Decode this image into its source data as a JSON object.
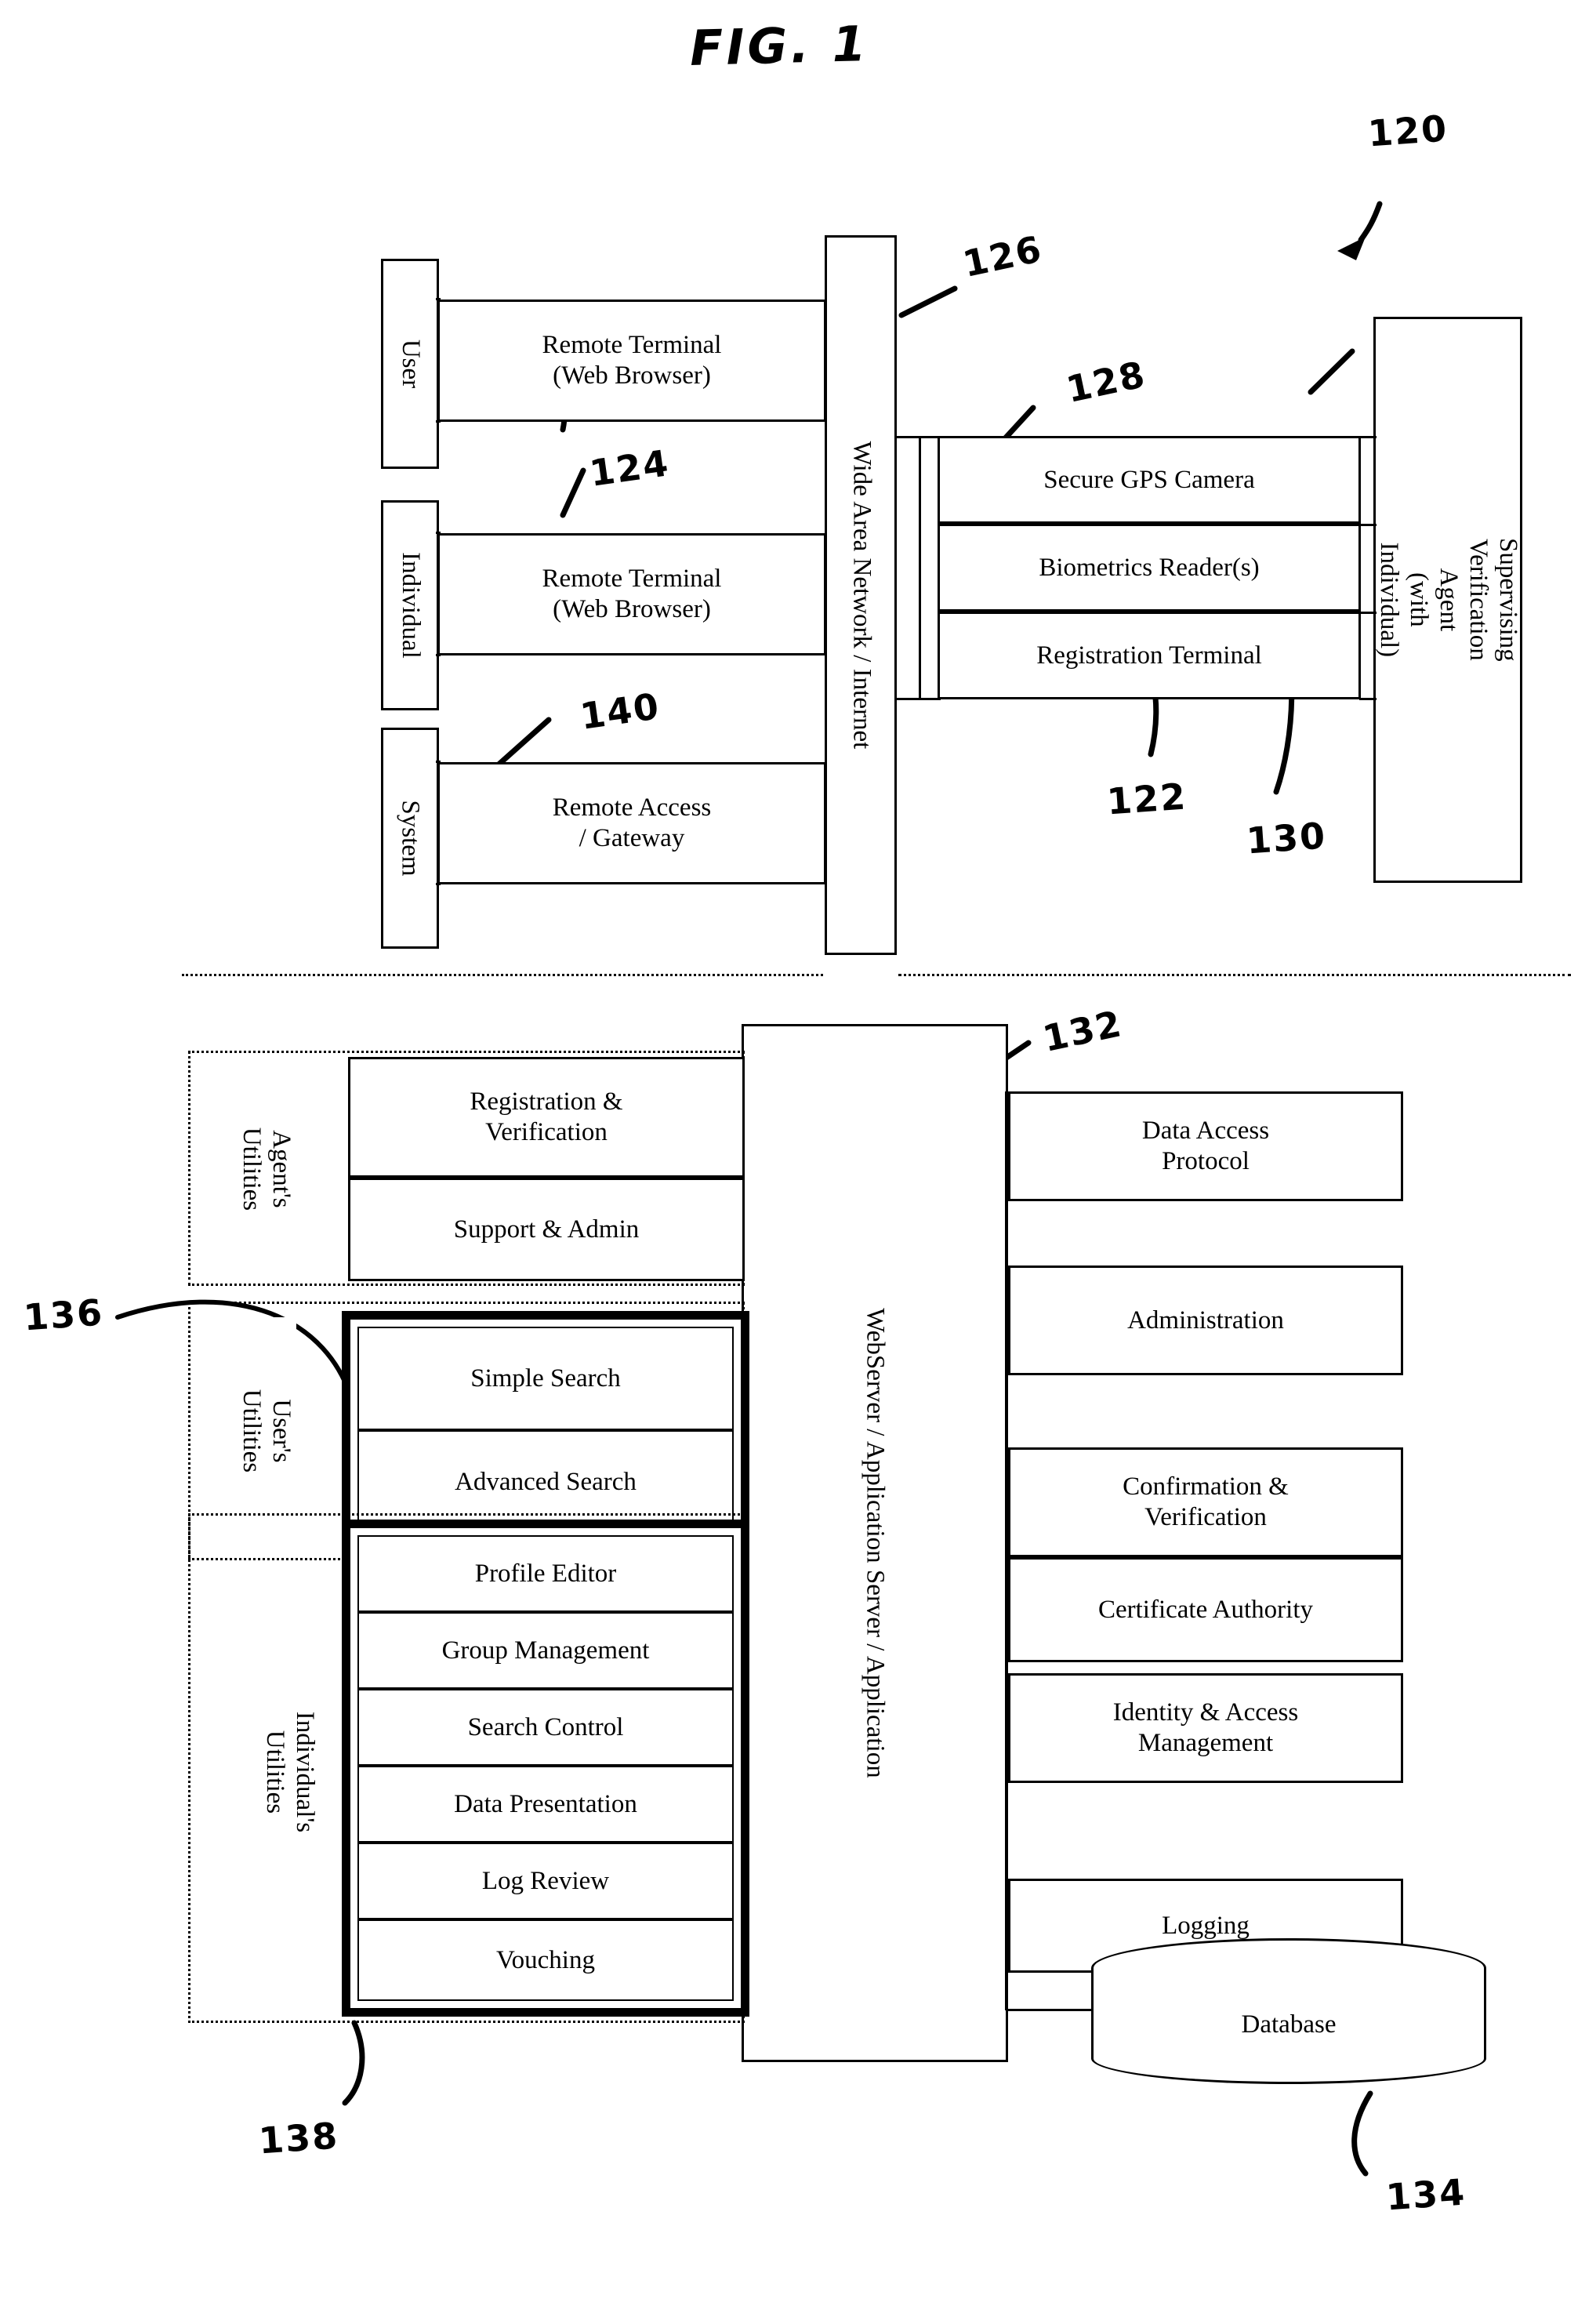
{
  "figure": {
    "title": "FIG. 1",
    "system_ref": "120"
  },
  "network": {
    "label": "Wide Area Network / Internet",
    "ref": "126"
  },
  "server": {
    "label": "WebServer / Application Server / Application",
    "ref": "132"
  },
  "actors": [
    {
      "label": "User"
    },
    {
      "label": "Individual"
    },
    {
      "label": "System"
    }
  ],
  "client_nodes": [
    {
      "label": "Remote Terminal\n(Web Browser)",
      "line1": "Remote Terminal",
      "line2": "(Web Browser)",
      "ref": ""
    },
    {
      "label": "Remote Terminal\n(Web Browser)",
      "line1": "Remote Terminal",
      "line2": "(Web Browser)",
      "ref": "124"
    },
    {
      "label": "Remote Access\n/ Gateway",
      "line1": "Remote Access",
      "line2": "/ Gateway",
      "ref": "140"
    }
  ],
  "capture_devices": {
    "items": [
      {
        "label": "Secure GPS Camera",
        "ref": "128"
      },
      {
        "label": "Biometrics Reader(s)",
        "ref": "130"
      },
      {
        "label": "Registration Terminal",
        "ref": "122"
      }
    ]
  },
  "agent_panel": {
    "label": "Supervising Verification Agent\n(with Individual)",
    "line1": "Supervising Verification Agent",
    "line2": "(with Individual)"
  },
  "utility_groups": [
    {
      "title": "Agent's Utilities",
      "emphasized": false,
      "ref": "",
      "items": [
        {
          "line1": "Registration &",
          "line2": "Verification"
        },
        {
          "line1": "Support & Admin",
          "line2": ""
        }
      ]
    },
    {
      "title": "User's Utilities",
      "emphasized": true,
      "ref": "136",
      "items": [
        {
          "line1": "Simple Search",
          "line2": ""
        },
        {
          "line1": "Advanced Search",
          "line2": ""
        }
      ]
    },
    {
      "title": "Individual's Utilities",
      "emphasized": true,
      "ref": "138",
      "items": [
        {
          "line1": "Profile Editor",
          "line2": ""
        },
        {
          "line1": "Group Management",
          "line2": ""
        },
        {
          "line1": "Search Control",
          "line2": ""
        },
        {
          "line1": "Data Presentation",
          "line2": ""
        },
        {
          "line1": "Log Review",
          "line2": ""
        },
        {
          "line1": "Vouching",
          "line2": ""
        }
      ]
    }
  ],
  "service_modules": [
    {
      "line1": "Data Access",
      "line2": "Protocol"
    },
    {
      "line1": "Administration",
      "line2": ""
    },
    {
      "line1": "Confirmation &",
      "line2": "Verification"
    },
    {
      "line1": "Certificate Authority",
      "line2": ""
    },
    {
      "line1": "Identity & Access",
      "line2": "Management"
    },
    {
      "line1": "Logging",
      "line2": ""
    }
  ],
  "database": {
    "label": "Database",
    "ref": "134"
  }
}
